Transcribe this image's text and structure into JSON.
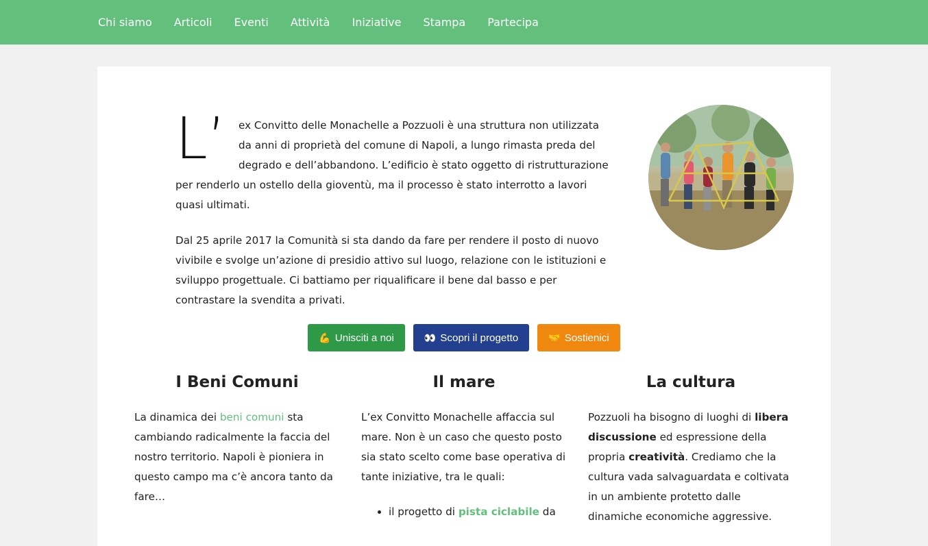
{
  "nav": {
    "items": [
      "Chi siamo",
      "Articoli",
      "Eventi",
      "Attività",
      "Iniziative",
      "Stampa",
      "Partecipa"
    ]
  },
  "intro": {
    "dropcap": "L’",
    "p1": "ex Convitto delle Monachelle a Pozzuoli è una struttura non utilizzata da anni di proprietà del comune di Napoli, a lungo rimasta preda del degrado e dell’abbandono. L’edificio è stato oggetto di ristrutturazione per renderlo un ostello della gioventù, ma il processo è stato interrotto a lavori quasi ultimati.",
    "p2": "Dal 25 aprile 2017 la Comunità si sta dando da fare per rendere il posto di nuovo vivibile e svolge un’azione di presidio attivo sul luogo, relazione con le istituzioni e sviluppo progettuale. Ci battiamo per riqualificare il bene dal basso e per contrastare la svendita a privati."
  },
  "buttons": {
    "join": {
      "emoji": "💪",
      "label": "Unisciti a noi"
    },
    "discover": {
      "emoji": "👀",
      "label": "Scopri il progetto"
    },
    "support": {
      "emoji": "🤝",
      "label": "Sostienici"
    }
  },
  "columns": {
    "beni": {
      "title": "I Beni Comuni",
      "pre": "La dinamica dei ",
      "link": "beni comuni",
      "post": " sta cambiando radicalmente la faccia del nostro territorio. Napoli è pioniera in questo campo ma c’è ancora tanto da fare…"
    },
    "mare": {
      "title": "Il mare",
      "text": "L’ex Convitto Monachelle affaccia sul mare. Non è un caso che questo posto sia stato scelto come base operativa di tante iniziative, tra le quali:",
      "li_pre": "il progetto di ",
      "li_link": "pista ciclabile",
      "li_post": " da"
    },
    "cultura": {
      "title": "La cultura",
      "t1": "Pozzuoli ha bisogno di luoghi di ",
      "b1": "libera discussione",
      "t2": " ed espressione della propria ",
      "b2": "creatività",
      "t3": ". Crediamo che la cultura vada salvaguardata e coltivata in un ambiente protetto dalle dinamiche economiche aggressive."
    }
  },
  "colors": {
    "nav_bg": "#62c07c",
    "btn_green": "#2e9a47",
    "btn_blue": "#22408f",
    "btn_orange": "#f0870e",
    "link": "#62c07c"
  }
}
